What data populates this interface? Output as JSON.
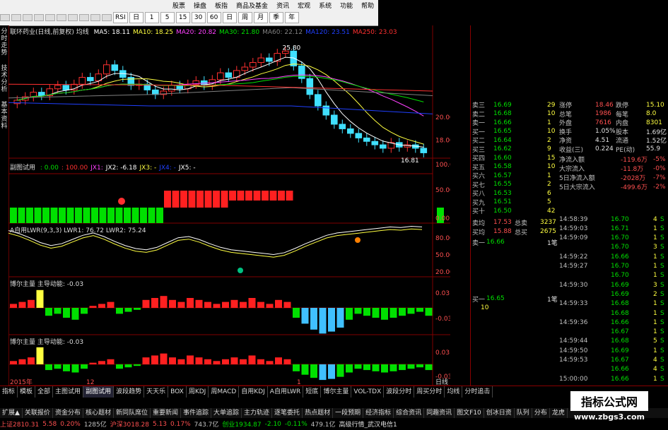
{
  "menu": [
    "股票",
    "操盘",
    "板指",
    "商品及基金",
    "资讯",
    "宏观",
    "系统",
    "功能",
    "帮助"
  ],
  "toolbar": {
    "buttons": [
      "RSI",
      "日",
      "1",
      "5",
      "15",
      "30",
      "60",
      "日",
      "周",
      "月",
      "季",
      "年"
    ]
  },
  "left_tabs": [
    "分时走势",
    "技术分析",
    "基本资料"
  ],
  "main": {
    "title": "联环药业(日线,前复权) 均线",
    "ma": [
      {
        "label": "MA5: 18.11",
        "color": "#ffffff"
      },
      {
        "label": "MA10: 18.25",
        "color": "#ffff40"
      },
      {
        "label": "MA20: 20.82",
        "color": "#ff40ff"
      },
      {
        "label": "MA30: 21.80",
        "color": "#00e000"
      },
      {
        "label": "MA60: 22.12",
        "color": "#808080"
      },
      {
        "label": "MA120: 23.51",
        "color": "#2040ff"
      },
      {
        "label": "MA250: 23.03",
        "color": "#ff3030"
      }
    ],
    "hi_label": "25.80",
    "lo_label": "16.81",
    "price_axis": [
      "20.00",
      "18.00"
    ],
    "sub1_title": "副图试用",
    "sub1_vals": [
      ": 0.00",
      ": 100.00",
      "JX1:",
      "JX2: -6.18",
      "JX3: -",
      "JX4: -",
      "JX5: -"
    ],
    "sub1_axis": [
      "100.0",
      "50.00",
      "0.00"
    ],
    "sub2_title": "A自用LWR(9,3,3)",
    "sub2_vals": [
      "LWR1: 76.72",
      "LWR2: 75.24"
    ],
    "sub2_axis": [
      "80.00",
      "50.00",
      "20.00"
    ],
    "sub3_title": "博尔主量  主导动能: -0.03",
    "sub3_axis": [
      "0.03",
      "-0.03"
    ],
    "sub4_title": "博尔主量  主导动能: -0.03",
    "sub4_axis": [
      "0.03",
      "-0.03"
    ],
    "date_axis": [
      "2015年",
      "12",
      "1"
    ],
    "right_label": "日线"
  },
  "quote": {
    "sell": [
      {
        "name": "卖三",
        "price": "16.69",
        "vol": "29"
      },
      {
        "name": "卖二",
        "price": "16.68",
        "vol": "10"
      },
      {
        "name": "卖一",
        "price": "16.66",
        "vol": "1"
      }
    ],
    "buy": [
      {
        "name": "买一",
        "price": "16.65",
        "vol": "10"
      },
      {
        "name": "买二",
        "price": "16.64",
        "vol": "2"
      },
      {
        "name": "买三",
        "price": "16.62",
        "vol": "9"
      },
      {
        "name": "买四",
        "price": "16.60",
        "vol": "15"
      },
      {
        "name": "买五",
        "price": "16.58",
        "vol": "10"
      },
      {
        "name": "买六",
        "price": "16.57",
        "vol": "1"
      },
      {
        "name": "买七",
        "price": "16.55",
        "vol": "2"
      },
      {
        "name": "买八",
        "price": "16.53",
        "vol": "6"
      },
      {
        "name": "买九",
        "price": "16.51",
        "vol": "5"
      },
      {
        "name": "买十",
        "price": "16.50",
        "vol": "42"
      }
    ],
    "avg": [
      {
        "name": "卖均",
        "price": "17.53",
        "tag": "总卖",
        "vol": "3237"
      },
      {
        "name": "买均",
        "price": "15.88",
        "tag": "总买",
        "vol": "2675"
      }
    ],
    "sell1b": {
      "name": "卖一",
      "price": "16.66",
      "vol": "1笔"
    },
    "buy1b": {
      "name": "买一",
      "price": "16.65",
      "vol": "1笔",
      "sub": "10"
    },
    "stats": [
      {
        "a": "涨停",
        "av": "18.46",
        "b": "跌停",
        "bv": "15.10"
      },
      {
        "a": "总笔",
        "av": "1986",
        "b": "每笔",
        "bv": "8.0"
      },
      {
        "a": "外盘",
        "av": "7616",
        "b": "内盘",
        "bv": "8301"
      },
      {
        "a": "换手",
        "av": "1.05%",
        "b": "股本",
        "bv": "1.69亿"
      },
      {
        "a": "净资",
        "av": "4.51",
        "b": "流通",
        "bv": "1.52亿"
      },
      {
        "a": "收益(三)",
        "av": "0.224",
        "b": "PE(动)",
        "bv": "55.9"
      }
    ],
    "flows": [
      {
        "name": "净流入额",
        "val": "-119.6万",
        "pct": "-5%"
      },
      {
        "name": "大宗流入",
        "val": "-11.8万",
        "pct": "-0%"
      },
      {
        "name": "5日净流入额",
        "val": "-2028万",
        "pct": "-7%"
      },
      {
        "name": "5日大宗流入",
        "val": "-499.6万",
        "pct": "-2%"
      }
    ],
    "ticks": [
      {
        "t": "14:58:39",
        "p": "16.70",
        "d": "4",
        "s": "S"
      },
      {
        "t": "14:59:03",
        "p": "16.71",
        "d": "1",
        "s": "S"
      },
      {
        "t": "14:59:09",
        "p": "16.70",
        "d": "1",
        "s": "S"
      },
      {
        "t": "",
        "p": "16.70",
        "d": "3",
        "s": "S"
      },
      {
        "t": "14:59:22",
        "p": "16.66",
        "d": "1",
        "s": "S"
      },
      {
        "t": "14:59:27",
        "p": "16.70",
        "d": "1",
        "s": "S"
      },
      {
        "t": "",
        "p": "16.70",
        "d": "1",
        "s": "S"
      },
      {
        "t": "14:59:30",
        "p": "16.69",
        "d": "3",
        "s": "S"
      },
      {
        "t": "",
        "p": "16.69",
        "d": "2",
        "s": "S"
      },
      {
        "t": "14:59:33",
        "p": "16.68",
        "d": "1",
        "s": "S"
      },
      {
        "t": "",
        "p": "16.68",
        "d": "1",
        "s": "S"
      },
      {
        "t": "14:59:36",
        "p": "16.66",
        "d": "1",
        "s": "S"
      },
      {
        "t": "",
        "p": "16.67",
        "d": "1",
        "s": "S"
      },
      {
        "t": "14:59:44",
        "p": "16.68",
        "d": "5",
        "s": "S"
      },
      {
        "t": "14:59:50",
        "p": "16.69",
        "d": "1",
        "s": "S"
      },
      {
        "t": "14:59:53",
        "p": "16.67",
        "d": "4",
        "s": "S"
      },
      {
        "t": "",
        "p": "16.66",
        "d": "4",
        "s": "S"
      },
      {
        "t": "15:00:00",
        "p": "16.66",
        "d": "1",
        "s": "S"
      }
    ]
  },
  "bottom_tabs": [
    "指标",
    "模板",
    "全部",
    "主图试用",
    "副图试用",
    "波段趋势",
    "天天乐",
    "BOX",
    "周KDJ",
    "周MACD",
    "自用KDJ",
    "A自用LWR",
    "短底",
    "博尔主量",
    "VOL-TDX",
    "波段分时",
    "周买分时",
    "均线",
    "分时追击"
  ],
  "bottom_tabs2": [
    "扩展▲",
    "关联报价",
    "资金分布",
    "核心题材",
    "新同队席位",
    "重要新闻",
    "事件追踪",
    "大单追踪",
    "主力轨迹",
    "逐笔委托",
    "热点题材",
    "一段预期",
    "经济指标",
    "综合资讯",
    "同趣资讯",
    "图文F10",
    "创冰日资",
    "队列",
    "分布",
    "龙虎"
  ],
  "status": [
    {
      "text": "上证2810.31",
      "color": "#ff5050"
    },
    {
      "text": "5.58",
      "color": "#ff5050"
    },
    {
      "text": "0.20%",
      "color": "#ff5050"
    },
    {
      "text": "1285亿",
      "color": "#c0c0c0"
    },
    {
      "text": "沪深3018.28",
      "color": "#ff5050"
    },
    {
      "text": "5.13",
      "color": "#ff5050"
    },
    {
      "text": "0.17%",
      "color": "#ff5050"
    },
    {
      "text": "743.7亿",
      "color": "#c0c0c0"
    },
    {
      "text": "创业1934.87",
      "color": "#00e000"
    },
    {
      "text": "-2.10",
      "color": "#00e000"
    },
    {
      "text": "-0.11%",
      "color": "#00e000"
    },
    {
      "text": "479.1亿",
      "color": "#c0c0c0"
    },
    {
      "text": "高级行情_武汉电信1",
      "color": "#e0e0e0"
    }
  ],
  "watermark": {
    "title": "指标公式网",
    "url": "www.zbgs3.com"
  },
  "colors": {
    "up": "#ff3030",
    "down": "#00e000",
    "grid": "#800000",
    "bg": "#000000"
  }
}
